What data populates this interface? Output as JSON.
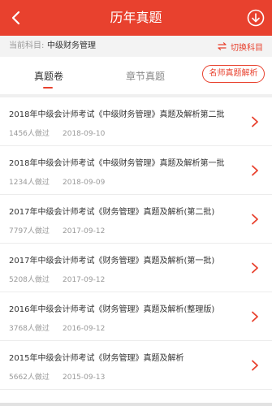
{
  "header": {
    "title": "历年真题"
  },
  "subject": {
    "label": "当前科目:",
    "value": "中级财务管理",
    "switch_label": "切换科目"
  },
  "tabs": [
    {
      "label": "真题卷",
      "active": true
    },
    {
      "label": "章节真题",
      "active": false
    }
  ],
  "expert_button": "名师真题解析",
  "items": [
    {
      "title": "2018年中级会计师考试《中级财务管理》真题及解析第二批",
      "count": "1456人做过",
      "date": "2018-09-10"
    },
    {
      "title": "2018年中级会计师考试《中级财务管理》真题及解析第一批",
      "count": "1234人做过",
      "date": "2018-09-09"
    },
    {
      "title": "2017年中级会计师考试《财务管理》真题及解析(第二批)",
      "count": "7797人做过",
      "date": "2017-09-12"
    },
    {
      "title": "2017年中级会计师考试《财务管理》真题及解析(第一批)",
      "count": "5208人做过",
      "date": "2017-09-12"
    },
    {
      "title": "2016年中级会计师考试《财务管理》真题及解析(整理版)",
      "count": "3768人做过",
      "date": "2016-09-12"
    },
    {
      "title": "2015年中级会计师考试《财务管理》真题及解析",
      "count": "5662人做过",
      "date": "2015-09-13"
    }
  ],
  "colors": {
    "accent": "#e8412e",
    "subject_bg": "#f3f3f3",
    "meta_text": "#999999"
  },
  "icons": {
    "back": "chevron-left-icon",
    "download": "download-circle-icon",
    "switch": "swap-arrows-icon",
    "row": "chevron-right-icon"
  }
}
